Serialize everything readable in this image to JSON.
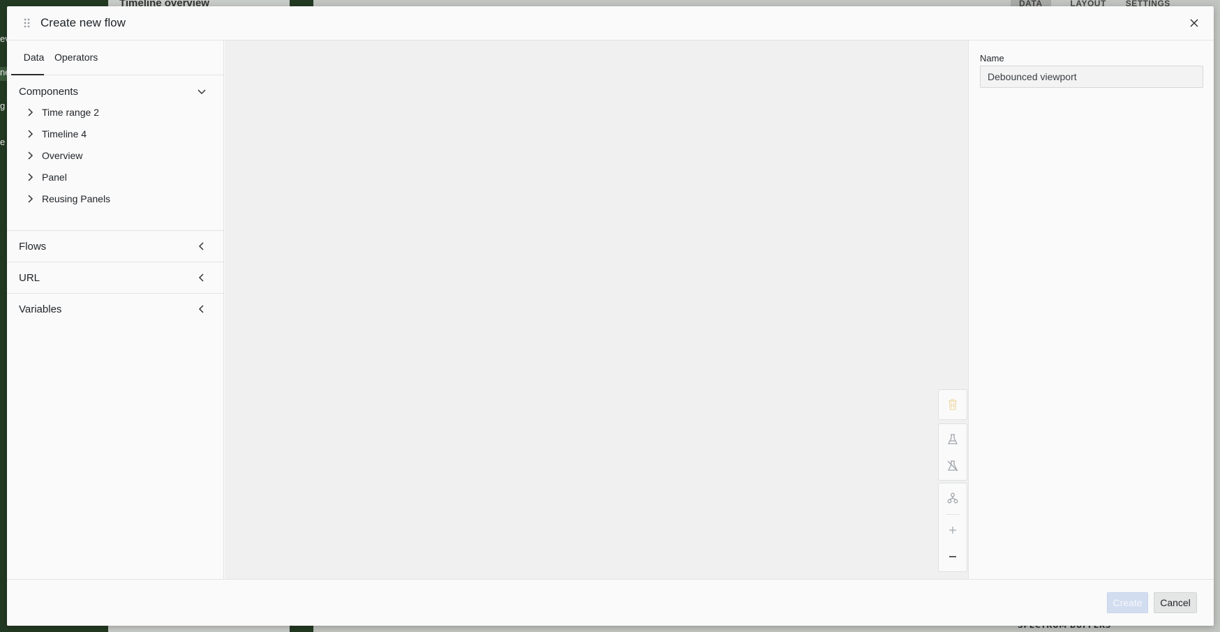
{
  "background": {
    "left_fragments": [
      "ev",
      "ne",
      "g",
      "e p"
    ],
    "title": "Timeline overview",
    "tabs": [
      "DATA",
      "LAYOUT",
      "SETTINGS"
    ],
    "footer_label": "SPECTRUM BUFFERS"
  },
  "modal": {
    "title": "Create new flow",
    "close_icon": "close-icon",
    "left_panel": {
      "tabs": [
        {
          "label": "Data",
          "active": true
        },
        {
          "label": "Operators",
          "active": false
        }
      ],
      "sections": {
        "components": {
          "label": "Components",
          "expanded": true,
          "items": [
            "Time range 2",
            "Timeline 4",
            "Overview",
            "Panel",
            "Reusing Panels"
          ]
        },
        "flows": {
          "label": "Flows",
          "expanded": false
        },
        "url": {
          "label": "URL",
          "expanded": false
        },
        "variables": {
          "label": "Variables",
          "expanded": false
        }
      }
    },
    "canvas_controls": [
      "trash-icon",
      "flask-icon",
      "flask-off-icon",
      "graph-layout-icon",
      "zoom-in-icon",
      "zoom-out-icon"
    ],
    "right_panel": {
      "name_label": "Name",
      "name_value": "Debounced viewport"
    },
    "footer": {
      "create_label": "Create",
      "cancel_label": "Cancel"
    },
    "colors": {
      "create_disabled_bg": "#d3ddf0",
      "trash_icon": "#f2d9a6",
      "canvas_bg": "#eff0ef"
    }
  }
}
